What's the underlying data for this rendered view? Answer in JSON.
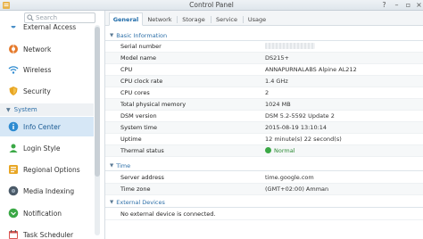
{
  "window": {
    "title": "Control Panel",
    "controls": [
      "help-icon",
      "minimize-icon",
      "maximize-icon",
      "close-icon"
    ]
  },
  "sidebar": {
    "search_placeholder": "Search",
    "items": [
      {
        "label": "External Access",
        "icon": "external-access-icon"
      },
      {
        "label": "Network",
        "icon": "network-icon"
      },
      {
        "label": "Wireless",
        "icon": "wireless-icon"
      },
      {
        "label": "Security",
        "icon": "security-icon"
      }
    ],
    "section": "System",
    "system_items": [
      {
        "label": "Info Center",
        "icon": "info-icon",
        "active": true
      },
      {
        "label": "Login Style",
        "icon": "login-style-icon"
      },
      {
        "label": "Regional Options",
        "icon": "regional-options-icon"
      },
      {
        "label": "Media Indexing",
        "icon": "media-indexing-icon"
      },
      {
        "label": "Notification",
        "icon": "notification-icon"
      },
      {
        "label": "Task Scheduler",
        "icon": "task-scheduler-icon"
      }
    ]
  },
  "tabs": [
    "General",
    "Network",
    "Storage",
    "Service",
    "Usage"
  ],
  "basic": {
    "header": "Basic Information",
    "rows": [
      {
        "label": "Serial number",
        "value": ""
      },
      {
        "label": "Model name",
        "value": "DS215+"
      },
      {
        "label": "CPU",
        "value": "ANNAPURNALABS Alpine AL212"
      },
      {
        "label": "CPU clock rate",
        "value": "1.4 GHz"
      },
      {
        "label": "CPU cores",
        "value": "2"
      },
      {
        "label": "Total physical memory",
        "value": "1024 MB"
      },
      {
        "label": "DSM version",
        "value": "DSM 5.2-5592 Update 2"
      },
      {
        "label": "System time",
        "value": "2015-08-19 13:10:14"
      },
      {
        "label": "Uptime",
        "value": "12 minute(s) 22 second(s)"
      },
      {
        "label": "Thermal status",
        "value": "Normal"
      }
    ]
  },
  "time": {
    "header": "Time",
    "rows": [
      {
        "label": "Server address",
        "value": "time.google.com"
      },
      {
        "label": "Time zone",
        "value": "(GMT+02:00) Amman"
      }
    ]
  },
  "external": {
    "header": "External Devices",
    "message": "No external device is connected."
  },
  "colors": {
    "accent": "#2c6fa8",
    "active_bg": "#d6e7f6",
    "status_ok": "#3aa845"
  }
}
